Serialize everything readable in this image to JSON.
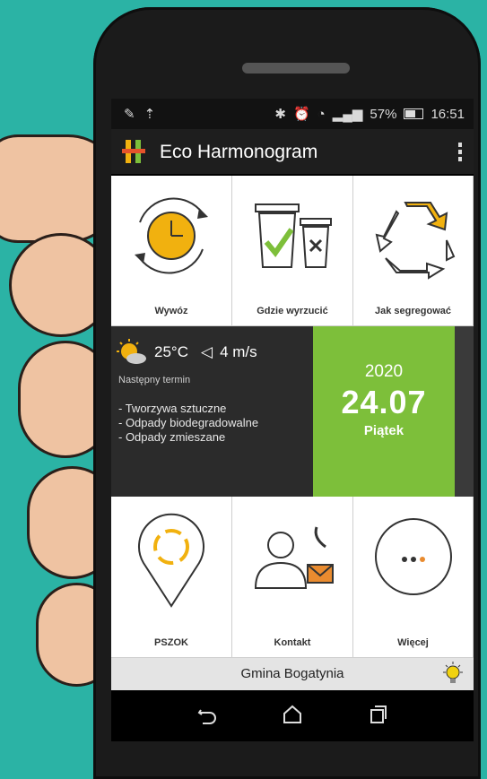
{
  "colors": {
    "teal_bg": "#2bb3a5",
    "green": "#7dbf3a",
    "yellow": "#f1b10f",
    "dark": "#2b2b2b"
  },
  "status": {
    "battery": "57%",
    "time": "16:51"
  },
  "appbar": {
    "title": "Eco Harmonogram",
    "logo_icon": "eco-logo-icon",
    "menu_icon": "overflow-menu-icon"
  },
  "tiles_top": [
    {
      "label": "Wywóz",
      "icon": "clock-cycle-icon"
    },
    {
      "label": "Gdzie wyrzucić",
      "icon": "bins-check-icon"
    },
    {
      "label": "Jak segregować",
      "icon": "recycle-icon"
    }
  ],
  "weather": {
    "temp": "25°C",
    "wind": "4 m/s",
    "icon": "sun-cloud-icon"
  },
  "next": {
    "heading": "Następny termin",
    "items": [
      "- Tworzywa sztuczne",
      "- Odpady biodegradowalne",
      "- Odpady zmieszane"
    ]
  },
  "date": {
    "year": "2020",
    "day": "24.07",
    "weekday": "Piątek"
  },
  "tiles_bottom": [
    {
      "label": "PSZOK",
      "icon": "pin-recycle-icon"
    },
    {
      "label": "Kontakt",
      "icon": "contact-person-icon"
    },
    {
      "label": "Więcej",
      "icon": "more-dots-icon"
    }
  ],
  "footer": {
    "gmina": "Gmina Bogatynia",
    "icon": "lightbulb-icon"
  }
}
